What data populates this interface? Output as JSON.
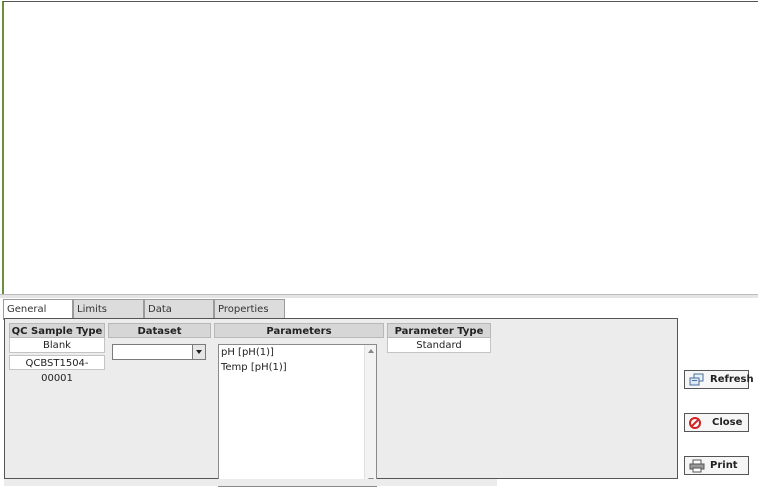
{
  "tabs": [
    {
      "label": "General",
      "active": true
    },
    {
      "label": "Limits",
      "active": false
    },
    {
      "label": "Data",
      "active": false
    },
    {
      "label": "Properties",
      "active": false
    }
  ],
  "qc_sample_type": {
    "header": "QC Sample Type",
    "value": "Blank",
    "sample_id": "QCBST1504-00001"
  },
  "dataset": {
    "header": "Dataset",
    "selected": ""
  },
  "parameters": {
    "header": "Parameters",
    "items": [
      "pH [pH(1)]",
      "Temp [pH(1)]"
    ]
  },
  "parameter_type": {
    "header": "Parameter Type",
    "value": "Standard"
  },
  "buttons": {
    "refresh": "Refresh",
    "close": "Close",
    "print": "Print"
  }
}
